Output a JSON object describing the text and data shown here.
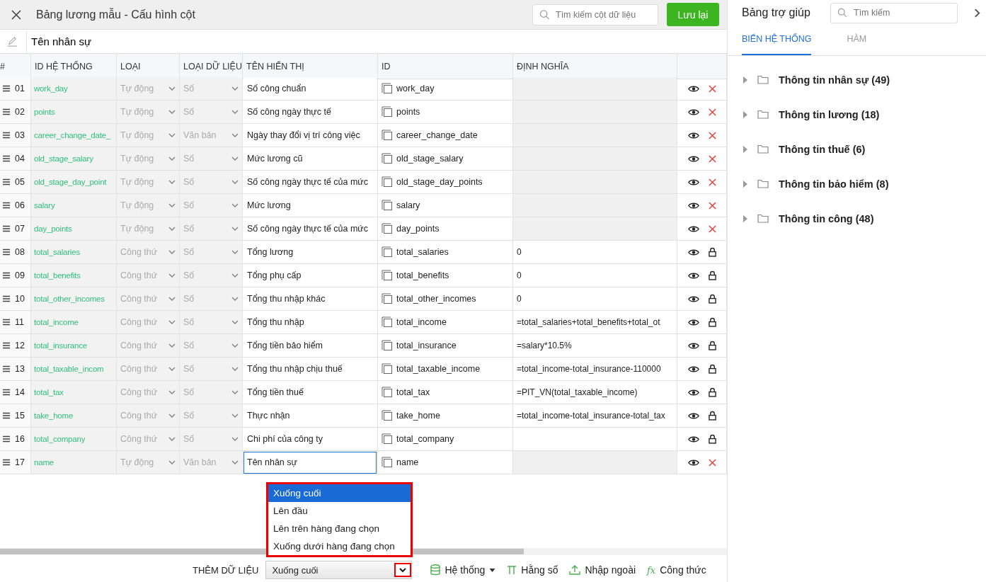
{
  "window": {
    "title": "Bảng lương mẫu - Cấu hình cột"
  },
  "header": {
    "search_placeholder": "Tìm kiếm cột dữ liệu",
    "save_button": "Lưu lại"
  },
  "name_field": {
    "value": "Tên nhân sự"
  },
  "table": {
    "columns": [
      "#",
      "ID HỆ THỐNG",
      "LOẠI",
      "LOẠI DỮ LIỆU",
      "TÊN HIỂN THỊ",
      "ID",
      "ĐỊNH NGHĨA"
    ],
    "rows": [
      {
        "number": "01",
        "system_id": "work_day",
        "type": "Tự động",
        "kind": "auto",
        "data_type": "Số",
        "display_name": "Số công chuẩn",
        "id": "work_day",
        "definition": "",
        "selected": false
      },
      {
        "number": "02",
        "system_id": "points",
        "type": "Tự động",
        "kind": "auto",
        "data_type": "Số",
        "display_name": "Số công ngày thực tế",
        "id": "points",
        "definition": "",
        "selected": false
      },
      {
        "number": "03",
        "system_id": "career_change_date_",
        "type": "Tự động",
        "kind": "auto",
        "data_type": "Văn bản",
        "display_name": "Ngày thay đổi vị trí công việc",
        "id": "career_change_date",
        "definition": "",
        "selected": false
      },
      {
        "number": "04",
        "system_id": "old_stage_salary",
        "type": "Tự động",
        "kind": "auto",
        "data_type": "Số",
        "display_name": "Mức lương cũ",
        "id": "old_stage_salary",
        "definition": "",
        "selected": false
      },
      {
        "number": "05",
        "system_id": "old_stage_day_point",
        "type": "Tự động",
        "kind": "auto",
        "data_type": "Số",
        "display_name": "Số công ngày thực tế của mức",
        "id": "old_stage_day_points",
        "definition": "",
        "selected": false
      },
      {
        "number": "06",
        "system_id": "salary",
        "type": "Tự động",
        "kind": "auto",
        "data_type": "Số",
        "display_name": "Mức lương",
        "id": "salary",
        "definition": "",
        "selected": false
      },
      {
        "number": "07",
        "system_id": "day_points",
        "type": "Tự động",
        "kind": "auto",
        "data_type": "Số",
        "display_name": "Số công ngày thực tế của mức",
        "id": "day_points",
        "definition": "",
        "selected": false
      },
      {
        "number": "08",
        "system_id": "total_salaries",
        "type": "Công thứ",
        "kind": "formula",
        "data_type": "Số",
        "display_name": "Tổng lương",
        "id": "total_salaries",
        "definition": "0",
        "selected": false
      },
      {
        "number": "09",
        "system_id": "total_benefits",
        "type": "Công thứ",
        "kind": "formula",
        "data_type": "Số",
        "display_name": "Tổng phụ cấp",
        "id": "total_benefits",
        "definition": "0",
        "selected": false
      },
      {
        "number": "10",
        "system_id": "total_other_incomes",
        "type": "Công thứ",
        "kind": "formula",
        "data_type": "Số",
        "display_name": "Tổng thu nhập khác",
        "id": "total_other_incomes",
        "definition": "0",
        "selected": false
      },
      {
        "number": "11",
        "system_id": "total_income",
        "type": "Công thứ",
        "kind": "formula",
        "data_type": "Số",
        "display_name": "Tổng thu nhập",
        "id": "total_income",
        "definition": "=total_salaries+total_benefits+total_ot",
        "selected": false
      },
      {
        "number": "12",
        "system_id": "total_insurance",
        "type": "Công thứ",
        "kind": "formula",
        "data_type": "Số",
        "display_name": "Tổng tiền bảo hiểm",
        "id": "total_insurance",
        "definition": "=salary*10.5%",
        "selected": false
      },
      {
        "number": "13",
        "system_id": "total_taxable_incom",
        "type": "Công thứ",
        "kind": "formula",
        "data_type": "Số",
        "display_name": "Tổng thu nhập chịu thuế",
        "id": "total_taxable_income",
        "definition": "=total_income-total_insurance-110000",
        "selected": false
      },
      {
        "number": "14",
        "system_id": "total_tax",
        "type": "Công thứ",
        "kind": "formula",
        "data_type": "Số",
        "display_name": "Tổng tiền thuế",
        "id": "total_tax",
        "definition": "=PIT_VN(total_taxable_income)",
        "selected": false
      },
      {
        "number": "15",
        "system_id": "take_home",
        "type": "Công thứ",
        "kind": "formula",
        "data_type": "Số",
        "display_name": "Thực nhận",
        "id": "take_home",
        "definition": "=total_income-total_insurance-total_tax",
        "selected": false
      },
      {
        "number": "16",
        "system_id": "total_company",
        "type": "Công thứ",
        "kind": "formula",
        "data_type": "Số",
        "display_name": "Chi phí của công ty",
        "id": "total_company",
        "definition": "",
        "selected": false
      },
      {
        "number": "17",
        "system_id": "name",
        "type": "Tự động",
        "kind": "auto",
        "data_type": "Văn bản",
        "display_name": "Tên nhân sự",
        "id": "name",
        "definition": "",
        "selected": true
      }
    ]
  },
  "footer": {
    "label": "THÊM DỮ LIỆU",
    "position_select": "Xuống cuối",
    "position_options": [
      {
        "label": "Xuống cuối",
        "selected": true
      },
      {
        "label": "Lên đầu",
        "selected": false
      },
      {
        "label": "Lên trên hàng đang chọn",
        "selected": false
      },
      {
        "label": "Xuống dưới hàng đang chọn",
        "selected": false
      }
    ],
    "buttons": [
      {
        "kind": "system",
        "label": "Hệ thống"
      },
      {
        "kind": "constant",
        "label": "Hằng số"
      },
      {
        "kind": "import",
        "label": "Nhập ngoài"
      },
      {
        "kind": "formula",
        "label": "Công thức",
        "icon": "fx"
      }
    ]
  },
  "help_panel": {
    "title": "Bảng trợ giúp",
    "search_placeholder": "Tìm kiếm",
    "tabs": [
      {
        "label": "BIẾN HỆ THỐNG",
        "selected": true
      },
      {
        "label": "HÀM",
        "selected": false
      }
    ],
    "tree": [
      {
        "label": "Thông tin nhân sự (49)",
        "expanded": false
      },
      {
        "label": "Thông tin lương (18)",
        "expanded": false
      },
      {
        "label": "Thông tin thuế (6)",
        "expanded": false
      },
      {
        "label": "Thông tin bảo hiểm (8)",
        "expanded": false
      },
      {
        "label": "Thông tin công (48)",
        "expanded": false
      }
    ]
  }
}
